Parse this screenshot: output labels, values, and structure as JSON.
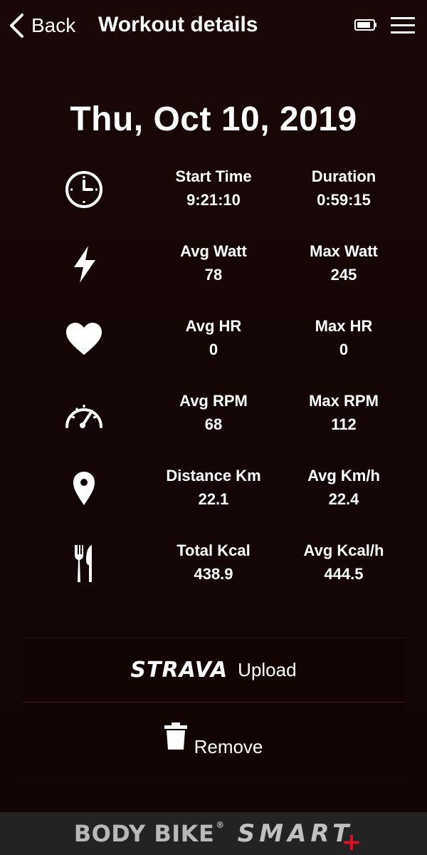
{
  "header": {
    "back_label": "Back",
    "title": "Workout details",
    "battery_icon": "battery-icon",
    "menu_icon": "hamburger-menu-icon"
  },
  "date": "Thu, Oct 10, 2019",
  "stats": [
    {
      "icon": "clock-icon",
      "left": {
        "label": "Start Time",
        "value": "9:21:10"
      },
      "right": {
        "label": "Duration",
        "value": "0:59:15"
      }
    },
    {
      "icon": "lightning-icon",
      "left": {
        "label": "Avg Watt",
        "value": "78"
      },
      "right": {
        "label": "Max Watt",
        "value": "245"
      }
    },
    {
      "icon": "heart-icon",
      "left": {
        "label": "Avg HR",
        "value": "0"
      },
      "right": {
        "label": "Max HR",
        "value": "0"
      }
    },
    {
      "icon": "speedometer-icon",
      "left": {
        "label": "Avg RPM",
        "value": "68"
      },
      "right": {
        "label": "Max RPM",
        "value": "112"
      }
    },
    {
      "icon": "location-pin-icon",
      "left": {
        "label": "Distance Km",
        "value": "22.1"
      },
      "right": {
        "label": "Avg Km/h",
        "value": "22.4"
      }
    },
    {
      "icon": "fork-knife-icon",
      "left": {
        "label": "Total Kcal",
        "value": "438.9"
      },
      "right": {
        "label": "Avg Kcal/h",
        "value": "444.5"
      }
    }
  ],
  "actions": {
    "strava_logo": "STRAVA",
    "upload_label": "Upload",
    "remove_label": "Remove"
  },
  "footer": {
    "brand_primary": "BODY BIKE",
    "brand_reg": "®",
    "brand_secondary": "SMART",
    "brand_plus": "+"
  },
  "colors": {
    "background": "#150606",
    "footer_bg": "#232323",
    "accent_red": "#e01020"
  }
}
